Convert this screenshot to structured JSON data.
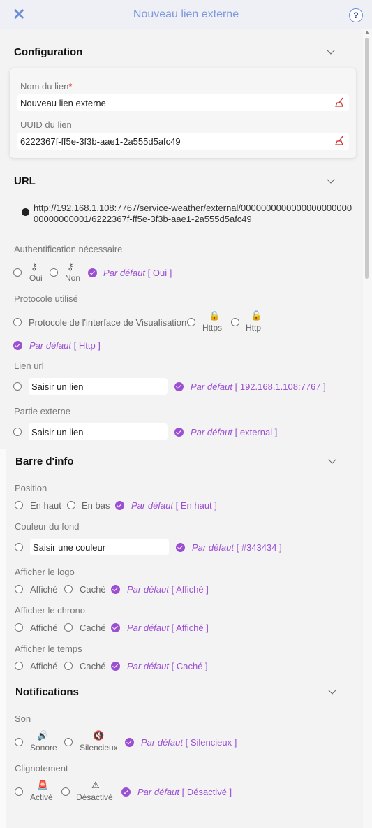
{
  "header": {
    "title": "Nouveau lien externe",
    "help_label": "?"
  },
  "configuration": {
    "title": "Configuration",
    "name_label": "Nom du lien",
    "name_required": "*",
    "name_value": "Nouveau lien externe",
    "uuid_label": "UUID du lien",
    "uuid_value": "6222367f-ff5e-3f3b-aae1-2a555d5afc49"
  },
  "url": {
    "title": "URL",
    "value": "http://192.168.1.108:7767/service-weather/external/000000000000000000000000000000001/6222367f-ff5e-3f3b-aae1-2a555d5afc49",
    "auth_label": "Authentification nécessaire",
    "auth_yes": "Oui",
    "auth_no": "Non",
    "auth_default_prefix": "Par défaut",
    "auth_default_value": "[ Oui ]",
    "protocol_label": "Protocole utilisé",
    "protocol_interface": "Protocole de l'interface de Visualisation",
    "protocol_https": "Https",
    "protocol_http": "Http",
    "protocol_default_prefix": "Par défaut",
    "protocol_default_value": "[ Http ]",
    "link_label": "Lien url",
    "link_placeholder": "Saisir un lien",
    "link_default_prefix": "Par défaut",
    "link_default_value": "[ 192.168.1.108:7767 ]",
    "external_label": "Partie externe",
    "external_placeholder": "Saisir un lien",
    "external_default_prefix": "Par défaut",
    "external_default_value": "[ external ]"
  },
  "infobar": {
    "title": "Barre d'info",
    "position_label": "Position",
    "pos_top": "En haut",
    "pos_bottom": "En bas",
    "pos_default_prefix": "Par défaut",
    "pos_default_value": "[ En haut ]",
    "bg_label": "Couleur du fond",
    "bg_placeholder": "Saisir une couleur",
    "bg_default_prefix": "Par défaut",
    "bg_default_value": "[ #343434 ]",
    "logo_label": "Afficher le logo",
    "logo_shown": "Affiché",
    "logo_hidden": "Caché",
    "logo_default_prefix": "Par défaut",
    "logo_default_value": "[ Affiché ]",
    "chrono_label": "Afficher le chrono",
    "chrono_shown": "Affiché",
    "chrono_hidden": "Caché",
    "chrono_default_prefix": "Par défaut",
    "chrono_default_value": "[ Affiché ]",
    "time_label": "Afficher le temps",
    "time_shown": "Affiché",
    "time_hidden": "Caché",
    "time_default_prefix": "Par défaut",
    "time_default_value": "[ Caché ]"
  },
  "notifications": {
    "title": "Notifications",
    "sound_label": "Son",
    "sound_on": "Sonore",
    "sound_off": "Silencieux",
    "sound_default_prefix": "Par défaut",
    "sound_default_value": "[ Silencieux ]",
    "blink_label": "Clignotement",
    "blink_on": "Activé",
    "blink_off": "Désactivé",
    "blink_default_prefix": "Par défaut",
    "blink_default_value": "[ Désactivé ]"
  },
  "colors": {
    "accent": "#9b4fd3",
    "header_text": "#7d98dc",
    "close": "#6d8ed6",
    "required": "#dd2222"
  }
}
